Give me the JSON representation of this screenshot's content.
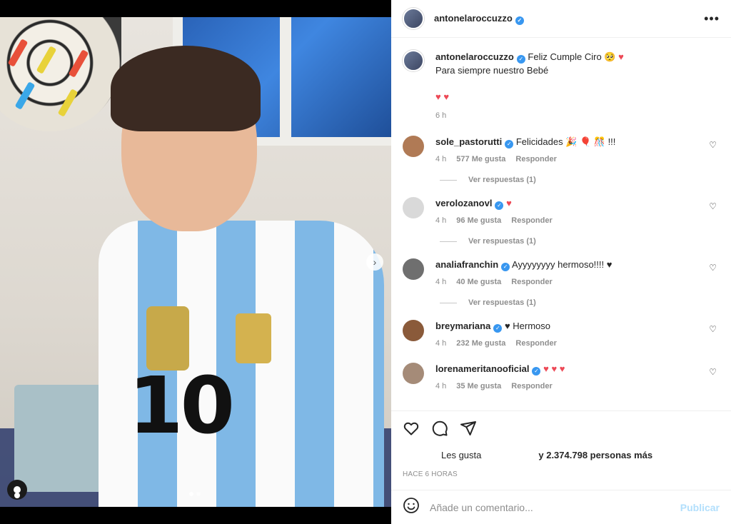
{
  "post": {
    "author": "antonelaroccuzzo",
    "more_label": "•••",
    "caption_line1": "Feliz Cumple Ciro 🥺",
    "caption_line2": "Para siempre nuestro Bebé",
    "caption_hearts": "♥ ♥",
    "time": "6 h"
  },
  "photo": {
    "jersey_number": "10",
    "slide_count": 2,
    "active_slide": 1
  },
  "comments": [
    {
      "user": "sole_pastorutti",
      "text": "Felicidades 🎉 🎈 🎊 !!!",
      "time": "4 h",
      "likes": "577 Me gusta",
      "reply": "Responder",
      "replies": "Ver respuestas (1)",
      "avatar_color": "#b07a55"
    },
    {
      "user": "verolozanovl",
      "text": "♥",
      "time": "4 h",
      "likes": "96 Me gusta",
      "reply": "Responder",
      "replies": "Ver respuestas (1)",
      "avatar_color": "#d9d9d9"
    },
    {
      "user": "analiafranchin",
      "text": "Ayyyyyyyy hermoso!!!! ♥",
      "time": "4 h",
      "likes": "40 Me gusta",
      "reply": "Responder",
      "replies": "Ver respuestas (1)",
      "avatar_color": "#6f6f6f"
    },
    {
      "user": "breymariana",
      "text": "♥ Hermoso",
      "time": "4 h",
      "likes": "232 Me gusta",
      "reply": "Responder",
      "replies": "",
      "avatar_color": "#8a5a3a"
    },
    {
      "user": "lorenameritanooficial",
      "text": "♥ ♥ ♥",
      "time": "4 h",
      "likes": "35 Me gusta",
      "reply": "Responder",
      "replies": "",
      "avatar_color": "#a58b78"
    }
  ],
  "actions": {
    "likes_prefix": "Les gusta",
    "likes_suffix": "y 2.374.798 personas más",
    "ago": "HACE 6 HORAS"
  },
  "add_comment": {
    "placeholder": "Añade un comentario...",
    "publish_label": "Publicar"
  },
  "colors": {
    "verified": "#3897f0",
    "heart": "#ed4956",
    "publish_disabled": "#b2dffc"
  }
}
